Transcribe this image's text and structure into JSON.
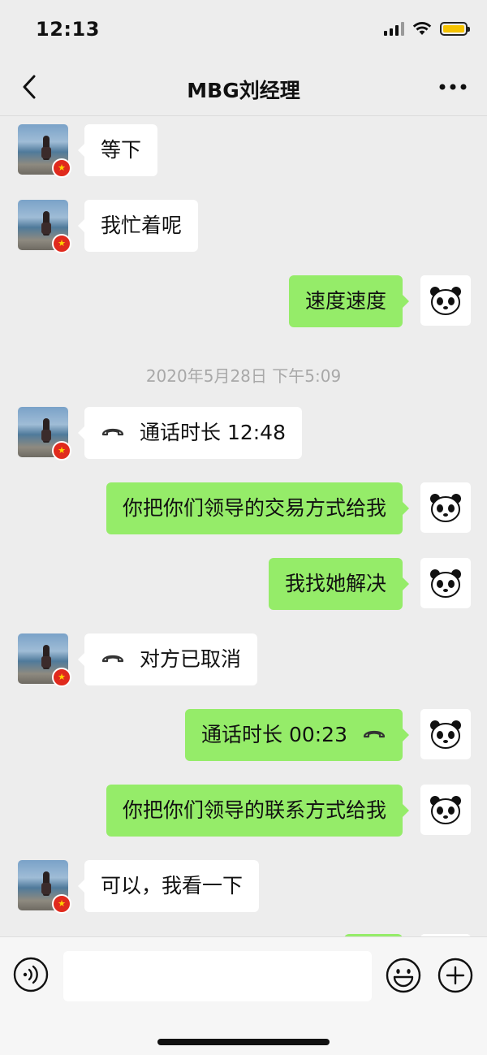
{
  "status_bar": {
    "time": "12:13",
    "battery_color": "#f5c200"
  },
  "nav": {
    "title": "MBG刘经理",
    "back_icon": "chevron-left-icon",
    "more_icon": "more-dots-icon"
  },
  "colors": {
    "background": "#ededed",
    "bubble_self": "#95ec69",
    "bubble_other": "#ffffff",
    "timestamp_text": "#a8a8a8"
  },
  "messages": [
    {
      "side": "left",
      "text": "等下"
    },
    {
      "side": "left",
      "text": "我忙着呢"
    },
    {
      "side": "right",
      "text": "速度速度"
    },
    {
      "type": "timestamp",
      "text": "2020年5月28日 下午5:09"
    },
    {
      "side": "left",
      "type": "call",
      "text": "通话时长 12:48"
    },
    {
      "side": "right",
      "text": "你把你们领导的交易方式给我"
    },
    {
      "side": "right",
      "text": "我找她解决"
    },
    {
      "side": "left",
      "type": "call",
      "text": "对方已取消"
    },
    {
      "side": "right",
      "type": "call",
      "text": "通话时长 00:23"
    },
    {
      "side": "right",
      "text": "你把你们领导的联系方式给我"
    },
    {
      "side": "left",
      "text": "可以，我看一下"
    }
  ],
  "input_bar": {
    "voice_icon": "voice-icon",
    "emoji_icon": "emoji-icon",
    "plus_icon": "plus-icon",
    "value": ""
  }
}
